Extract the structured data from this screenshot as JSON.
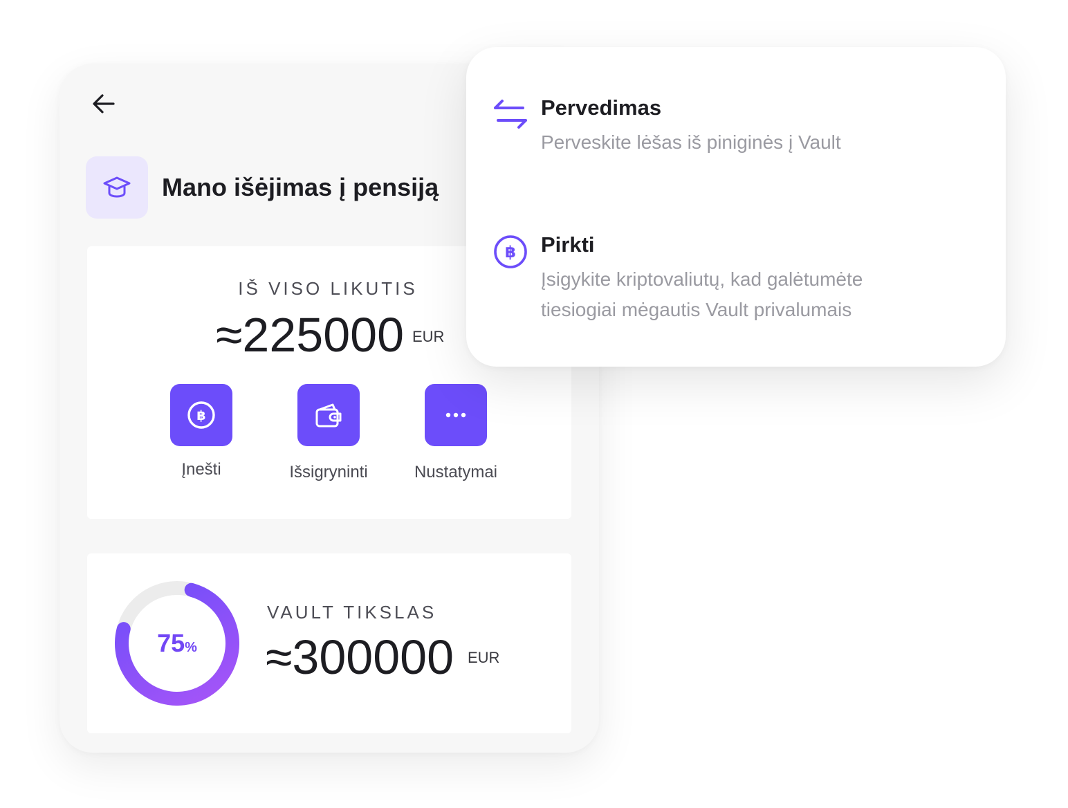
{
  "goal": {
    "title": "Mano išėjimas į pensiją",
    "icon": "graduation-cap-icon"
  },
  "balance": {
    "label": "IŠ VISO LIKUTIS",
    "amount": "≈225000",
    "currency": "EUR"
  },
  "actions": [
    {
      "label": "Įnešti",
      "icon": "bitcoin-icon"
    },
    {
      "label": "Išsigryninti",
      "icon": "wallet-icon"
    },
    {
      "label": "Nustatymai",
      "icon": "more-icon"
    }
  ],
  "vault_goal": {
    "label": "VAULT TIKSLAS",
    "amount": "≈300000",
    "currency": "EUR",
    "progress_percent": 75,
    "progress_number": "75",
    "progress_suffix": "%"
  },
  "menu": {
    "items": [
      {
        "title": "Pervedimas",
        "description": "Perveskite lėšas iš piniginės į Vault",
        "icon": "transfer-arrows-icon"
      },
      {
        "title": "Pirkti",
        "description_line1": "Įsigykite kriptovaliutų, kad galėtumėte",
        "description_line2": "tiesiogiai mėgautis Vault privalumais",
        "icon": "bitcoin-icon"
      }
    ]
  },
  "colors": {
    "accent": "#6c4dfa",
    "accent_light": "#ebe7fd",
    "ring_gradient_start": "#a855f7",
    "ring_gradient_end": "#6c4dfa",
    "ring_track": "#ececec"
  }
}
